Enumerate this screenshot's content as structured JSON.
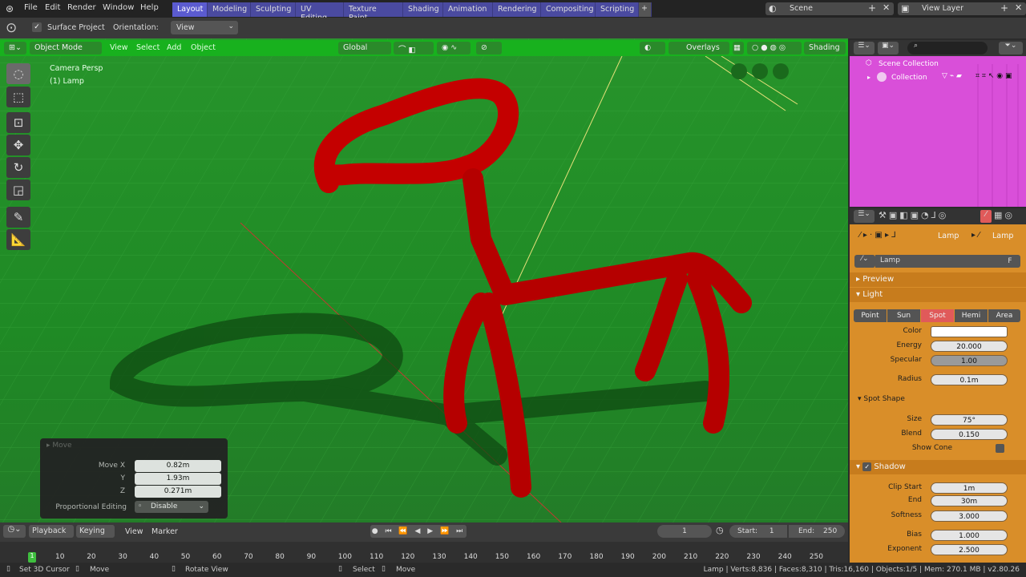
{
  "topbar": {
    "menus": [
      "File",
      "Edit",
      "Render",
      "Window",
      "Help"
    ],
    "workspaces": [
      "Layout",
      "Modeling",
      "Sculpting",
      "UV Editing",
      "Texture Paint",
      "Shading",
      "Animation",
      "Rendering",
      "Compositing",
      "Scripting"
    ],
    "add_tab": "+",
    "scene": "Scene",
    "view_layer": "View Layer"
  },
  "toolheader": {
    "surface_project": "Surface Project",
    "orientation_label": "Orientation:",
    "orientation_value": "View"
  },
  "viewport": {
    "mode": "Object Mode",
    "menus": [
      "View",
      "Select",
      "Add",
      "Object"
    ],
    "transform_space": "Global",
    "overlays": "Overlays",
    "shading": "Shading",
    "camera_label": "Camera Persp",
    "object_label": "(1) Lamp"
  },
  "operator": {
    "title": "Move",
    "move_x_label": "Move X",
    "move_x": "0.82m",
    "y_label": "Y",
    "y": "1.93m",
    "z_label": "Z",
    "z": "0.271m",
    "prop_label": "Proportional Editing",
    "prop_value": "Disable"
  },
  "outliner": {
    "scene_collection": "Scene Collection",
    "collection": "Collection"
  },
  "properties": {
    "breadcrumb": [
      "Lamp",
      "Lamp"
    ],
    "datablock": "Lamp",
    "fake_user": "F",
    "preview": "Preview",
    "light": "Light",
    "types": [
      "Point",
      "Sun",
      "Spot",
      "Hemi",
      "Area"
    ],
    "active_type": "Spot",
    "color_label": "Color",
    "energy_label": "Energy",
    "energy": "20.000",
    "specular_label": "Specular",
    "specular": "1.00",
    "radius_label": "Radius",
    "radius": "0.1m",
    "spot_shape": "Spot Shape",
    "size_label": "Size",
    "size": "75°",
    "blend_label": "Blend",
    "blend": "0.150",
    "show_cone": "Show Cone",
    "shadow": "Shadow",
    "clip_start_label": "Clip Start",
    "clip_start": "1m",
    "end_label": "End",
    "end": "30m",
    "softness_label": "Softness",
    "softness": "3.000",
    "bias_label": "Bias",
    "bias": "1.000",
    "exponent_label": "Exponent",
    "exponent": "2.500"
  },
  "timeline": {
    "playback": "Playback",
    "keying": "Keying",
    "view": "View",
    "marker": "Marker",
    "current_frame": "1",
    "start_label": "Start:",
    "start": "1",
    "end_label": "End:",
    "end": "250",
    "ticks": [
      "10",
      "20",
      "30",
      "40",
      "50",
      "60",
      "70",
      "80",
      "90",
      "100",
      "110",
      "120",
      "130",
      "140",
      "150",
      "160",
      "170",
      "180",
      "190",
      "200",
      "210",
      "220",
      "230",
      "240",
      "250"
    ],
    "frame_marker": "1"
  },
  "statusbar": {
    "set_cursor": "Set 3D Cursor",
    "move": "Move",
    "rotate": "Rotate View",
    "select": "Select",
    "move2": "Move",
    "stats": "Lamp | Verts:8,836 | Faces:8,310 | Tris:16,160 | Objects:1/5 | Mem: 270.1 MB | v2.80.26"
  },
  "colors": {
    "viewport_header": "#18b11e",
    "outliner_bg": "#d94fd9",
    "properties_bg": "#d98e29",
    "workspace_tab": "#5b5bd0",
    "model": "#c00000"
  }
}
